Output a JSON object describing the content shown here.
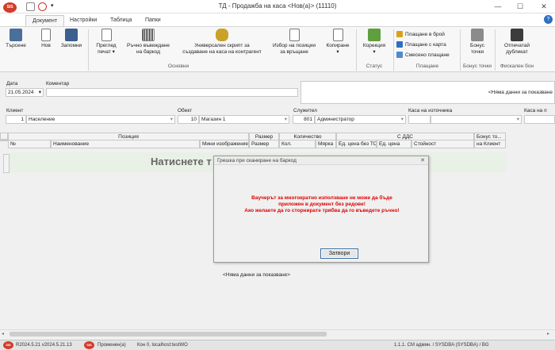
{
  "window": {
    "title": "ТД - Продажба на каса <Нов(а)> (11110)",
    "logo_text": "SIS",
    "minimize": "—",
    "maximize": "☐",
    "close": "✕",
    "help": "?"
  },
  "tabs": [
    "Документ",
    "Настройки",
    "Таблица",
    "Папки"
  ],
  "ribbon": {
    "buttons": {
      "search": "Търсене",
      "new": "Нов",
      "save": "Запомни",
      "preview_l1": "Преглед",
      "preview_l2": "печат ▾",
      "manual_l1": "Ръчно въвеждане",
      "manual_l2": "на баркод",
      "script_l1": "Универсален скрипт за",
      "script_l2": "създаване на каса на контрагент",
      "pick_l1": "Избор на позиции",
      "pick_l2": "за връщане",
      "copy_l1": "Копиране",
      "copy_l2": "▾",
      "correction_l1": "Корекция",
      "correction_l2": "▾",
      "bonus_l1": "Бонус",
      "bonus_l2": "точки",
      "dup_l1": "Отпечатай",
      "dup_l2": "дубликат"
    },
    "payment": [
      "Плащане в брой",
      "Плащане с карта",
      "Смесено плащане"
    ],
    "groups": {
      "main": "Основни",
      "status": "Статус",
      "payment": "Плащане",
      "bonus": "Бонус точки",
      "fiscal": "Фискален бон"
    }
  },
  "form": {
    "date_label": "Дата",
    "date_value": "21.05.2024",
    "comment_label": "Коментар",
    "nodata_right": "<Няма данни за показване",
    "client_label": "Клиент",
    "client_code": "1",
    "client_name": "Население",
    "object_label": "Обект",
    "object_code": "10",
    "object_name": "Магазин 1",
    "employee_label": "Служител",
    "employee_code": "801",
    "employee_name": "Администратор",
    "source_cash_label": "Каса на източника",
    "cash_label": "Каса на п"
  },
  "grid": {
    "group_headers": [
      "Позиция",
      "Размер",
      "Количество",
      "С ДДС",
      "Бонус то..."
    ],
    "columns": [
      "№",
      "Наименование",
      "Мини изображение",
      "Размер",
      "Кол.",
      "Мярка",
      "Ед. цена без ТО",
      "Ед. цена",
      "Стойност",
      "на Клиент"
    ],
    "scan_prompt": "Натиснете т",
    "nodata": "<Няма данни за показване>"
  },
  "dialog": {
    "title": "Грешка при сканиране на баркод",
    "close": "✕",
    "line1": "Ваучерът за многократно използване не може да бъде",
    "line2": "приложен в документ без редове!",
    "line3": "Ако желаете да го сторнирате трябва да го въведете ръчно!",
    "ok": "Затвори"
  },
  "status": {
    "version": "R2024.5.21 v2024.5.21.13",
    "changed": "Променен(а)",
    "connection": "Кон 0, localhost:testWO",
    "user": "1.1.1. СМ админ. / SYSDBA (SYSDBA) / BG"
  },
  "colors": {
    "accent_red": "#d23c2a",
    "error_text": "#e00000",
    "banner_bg": "#e9f0e6"
  }
}
